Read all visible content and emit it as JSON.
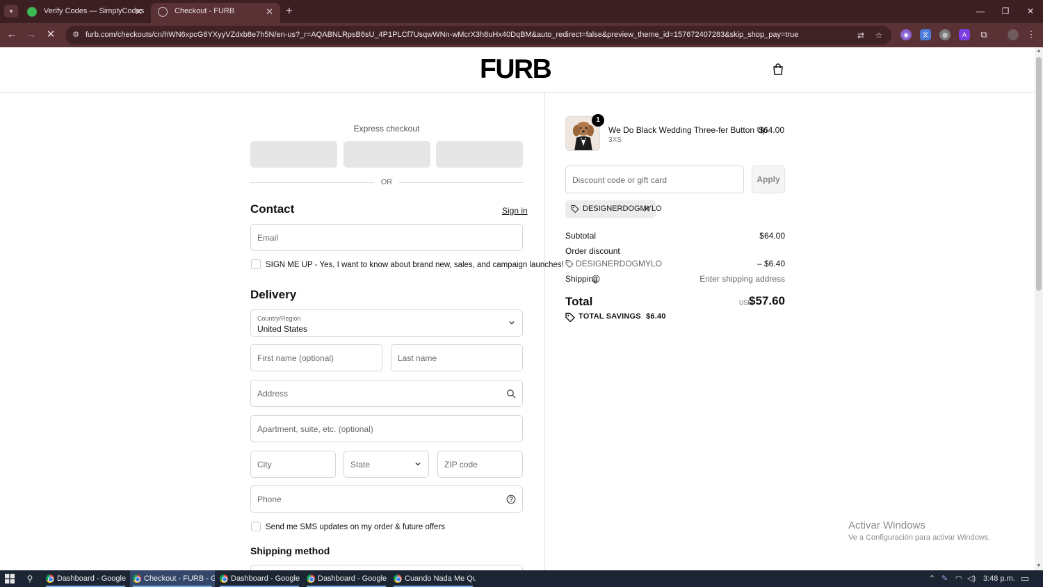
{
  "browser": {
    "tabs": [
      {
        "title": "Verify Codes — SimplyCodes",
        "active": false
      },
      {
        "title": "Checkout - FURB",
        "active": true
      }
    ],
    "url": "furb.com/checkouts/cn/hWN6xpcG6YXyyVZdxb8e7h5N/en-us?_r=AQABNLRpsB6sU_4P1PLCf7UsqwWNn-wMcrX3h8uHx40DqBM&auto_redirect=false&preview_theme_id=157672407283&skip_shop_pay=true"
  },
  "header": {
    "logo": "FURB"
  },
  "checkout": {
    "express_title": "Express checkout",
    "or_text": "OR",
    "contact_title": "Contact",
    "signin_label": "Sign in",
    "email_placeholder": "Email",
    "newsletter_label": "SIGN ME UP - Yes, I want to know about brand new, sales, and campaign launches!",
    "delivery_title": "Delivery",
    "country_label": "Country/Region",
    "country_value": "United States",
    "first_name_placeholder": "First name (optional)",
    "last_name_placeholder": "Last name",
    "address_placeholder": "Address",
    "apartment_placeholder": "Apartment, suite, etc. (optional)",
    "city_placeholder": "City",
    "state_placeholder": "State",
    "zip_placeholder": "ZIP code",
    "phone_placeholder": "Phone",
    "sms_label": "Send me SMS updates on my order & future offers",
    "shipping_method_title": "Shipping method"
  },
  "summary": {
    "product": {
      "name": "We Do Black Wedding Three-fer Button Up",
      "variant": "3XS",
      "price": "$64.00",
      "quantity": "1"
    },
    "discount_placeholder": "Discount code or gift card",
    "apply_label": "Apply",
    "applied_code": "DESIGNERDOGMYLO",
    "subtotal_label": "Subtotal",
    "subtotal_value": "$64.00",
    "order_discount_label": "Order discount",
    "discount_code": "DESIGNERDOGMYLO",
    "discount_value": "– $6.40",
    "shipping_label": "Shipping",
    "shipping_value": "Enter shipping address",
    "total_label": "Total",
    "currency": "USD",
    "total_value": "$57.60",
    "savings_label": "TOTAL SAVINGS",
    "savings_value": "$6.40"
  },
  "watermark": {
    "line1": "Activar Windows",
    "line2": "Ve a Configuración para activar Windows."
  },
  "taskbar": {
    "items": [
      {
        "label": "Dashboard - Google ...",
        "active": false
      },
      {
        "label": "Checkout - FURB - G...",
        "active": true
      },
      {
        "label": "Dashboard - Google ...",
        "active": false
      },
      {
        "label": "Dashboard - Google ...",
        "active": false
      },
      {
        "label": "Cuando Nada Me Qu...",
        "active": false
      }
    ],
    "clock": "3:48 p.m."
  },
  "colors": {
    "tabbar": "#3c1f22",
    "toolbar": "#5a3134",
    "accent": "#000000",
    "taskbar": "#1b2533"
  },
  "icons": [
    "search-icon",
    "cart-icon",
    "chevron-down-icon",
    "help-icon",
    "tag-icon",
    "close-icon",
    "savings-tag-icon"
  ]
}
